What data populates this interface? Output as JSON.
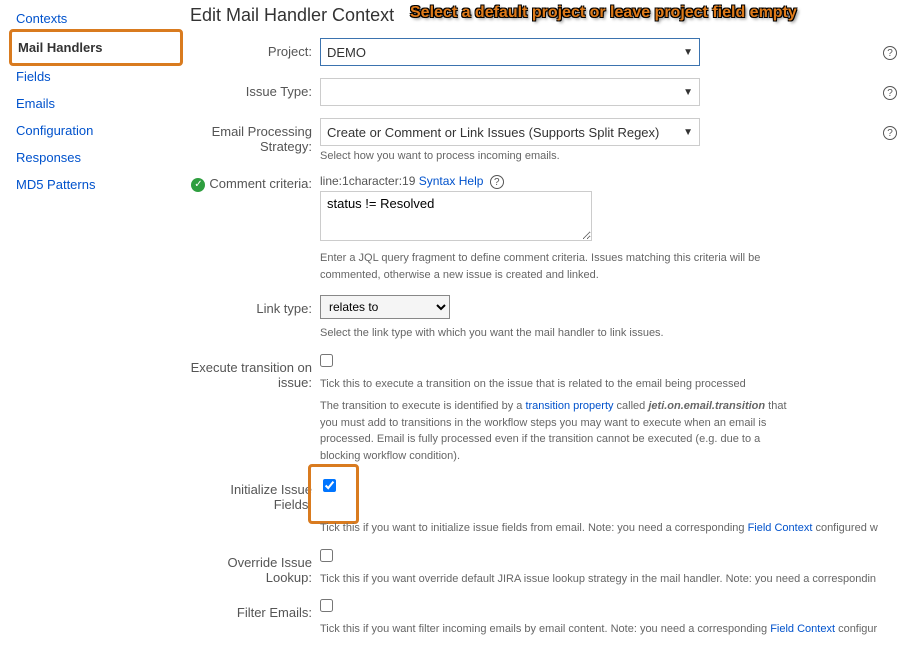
{
  "sidebar": {
    "items": [
      {
        "label": "Contexts"
      },
      {
        "label": "Mail Handlers"
      },
      {
        "label": "Fields"
      },
      {
        "label": "Emails"
      },
      {
        "label": "Configuration"
      },
      {
        "label": "Responses"
      },
      {
        "label": "MD5 Patterns"
      }
    ]
  },
  "page_title": "Edit Mail Handler Context",
  "annotation": "Select a default project or leave project field empty",
  "form": {
    "project": {
      "label": "Project:",
      "value": "DEMO"
    },
    "issue_type": {
      "label": "Issue Type:",
      "value": ""
    },
    "strategy": {
      "label": "Email Processing Strategy:",
      "value": "Create or Comment or Link Issues (Supports Split Regex)"
    },
    "strategy_hint": "Select how you want to process incoming emails.",
    "comment_criteria": {
      "label": "Comment criteria:",
      "top_text_a": "line:1character:19",
      "syntax_help": "Syntax Help",
      "textarea_value": "status != Resolved",
      "desc": "Enter a JQL query fragment to define comment criteria. Issues matching this criteria will be commented, otherwise a new issue is created and linked."
    },
    "link_type": {
      "label": "Link type:",
      "value": "relates to",
      "desc": "Select the link type with which you want the mail handler to link issues."
    },
    "execute_transition": {
      "label": "Execute transition on issue:",
      "desc1": "Tick this to execute a transition on the issue that is related to the email being processed",
      "desc2a": "The transition to execute is identified by a ",
      "desc2_link": "transition property",
      "desc2b": " called ",
      "desc2_it": "jeti.on.email.transition",
      "desc2c": " that you must add to transitions in the workflow steps you may want to execute when an email is processed. Email is fully processed even if the transition cannot be executed (e.g. due to a blocking workflow condition)."
    },
    "initialize_fields": {
      "label": "Initialize Issue Fields:",
      "desc_a": "Tick this if you want to initialize issue fields from email. Note: you need a corresponding ",
      "desc_link": "Field Context",
      "desc_b": " configured w"
    },
    "override_lookup": {
      "label": "Override Issue Lookup:",
      "desc": "Tick this if you want override default JIRA issue lookup strategy in the mail handler. Note: you need a correspondin"
    },
    "filter_emails": {
      "label": "Filter Emails:",
      "desc_a": "Tick this if you want filter incoming emails by email content. Note: you need a corresponding ",
      "desc_link": "Field Context",
      "desc_b": " configur"
    }
  }
}
